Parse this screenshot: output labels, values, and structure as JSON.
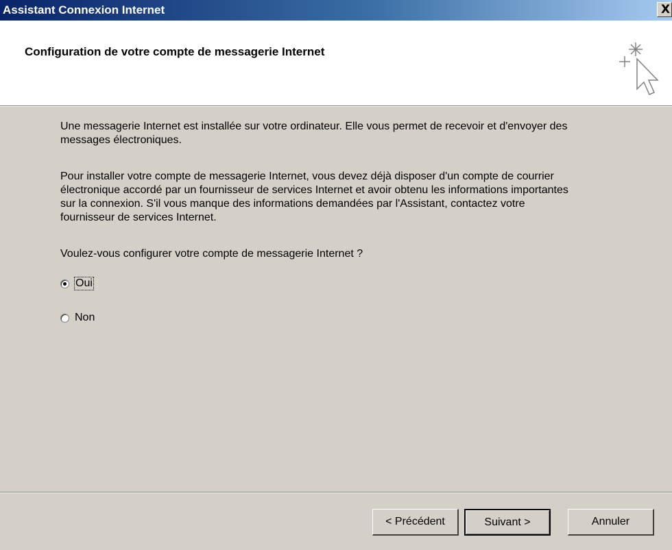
{
  "window": {
    "title": "Assistant Connexion Internet",
    "close_label": "X"
  },
  "header": {
    "heading": "Configuration de votre compte de messagerie Internet",
    "icon": "wizard-cursor-icon"
  },
  "content": {
    "paragraph1": "Une messagerie Internet est installée sur votre ordinateur. Elle vous permet de recevoir et d'envoyer des messages électroniques.",
    "paragraph2": "Pour installer votre compte de messagerie Internet, vous devez déjà disposer d'un compte de courrier électronique accordé par un fournisseur de services Internet et avoir obtenu les informations importantes sur la connexion. S'il vous manque des informations demandées par l'Assistant, contactez votre fournisseur de services Internet.",
    "question": "Voulez-vous configurer votre compte de messagerie Internet ?",
    "options": [
      {
        "label": "Oui",
        "checked": true
      },
      {
        "label": "Non",
        "checked": false
      }
    ]
  },
  "buttons": {
    "previous": "< Précédent",
    "next": "Suivant >",
    "cancel": "Annuler"
  }
}
